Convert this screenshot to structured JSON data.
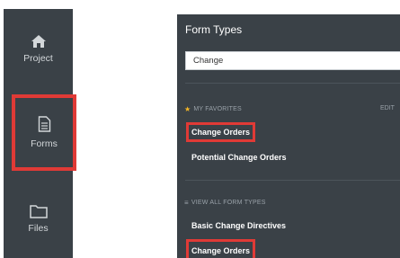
{
  "nav": {
    "items": [
      {
        "label": "Project"
      },
      {
        "label": "Forms"
      },
      {
        "label": "Files"
      }
    ]
  },
  "panel": {
    "title": "Form Types",
    "search_value": "Change",
    "favorites": {
      "header": "MY FAVORITES",
      "edit_label": "EDIT",
      "items": [
        "Change Orders",
        "Potential Change Orders"
      ]
    },
    "all_types": {
      "header": "VIEW ALL FORM TYPES",
      "items": [
        "Basic Change Directives",
        "Change Orders"
      ]
    }
  },
  "colors": {
    "highlight": "#e03a36",
    "favorite_star": "#f6b726",
    "panel_bg": "#3a4147"
  }
}
